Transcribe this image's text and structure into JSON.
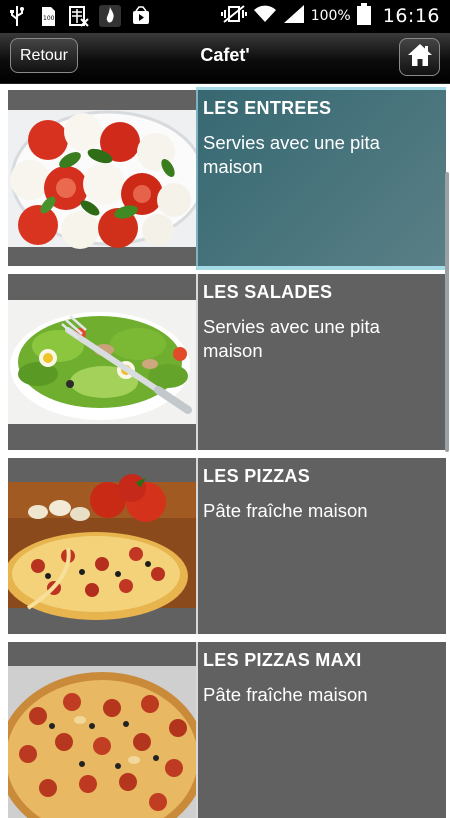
{
  "status_bar": {
    "battery_text": "100%",
    "time": "16:16",
    "small_badge": "100"
  },
  "header": {
    "back_label": "Retour",
    "title": "Cafet'"
  },
  "menu": {
    "items": [
      {
        "title": "LES ENTREES",
        "description": "Servies avec une pita maison"
      },
      {
        "title": "LES SALADES",
        "description": "Servies avec une pita maison"
      },
      {
        "title": "LES PIZZAS",
        "description": "Pâte fraîche maison"
      },
      {
        "title": "LES PIZZAS MAXI",
        "description": "Pâte fraîche maison"
      }
    ]
  },
  "colors": {
    "item_bg": "#616161",
    "selected_bg": "#3d6d76",
    "highlight": "#a5dbe6",
    "titlebar": "#000000"
  }
}
